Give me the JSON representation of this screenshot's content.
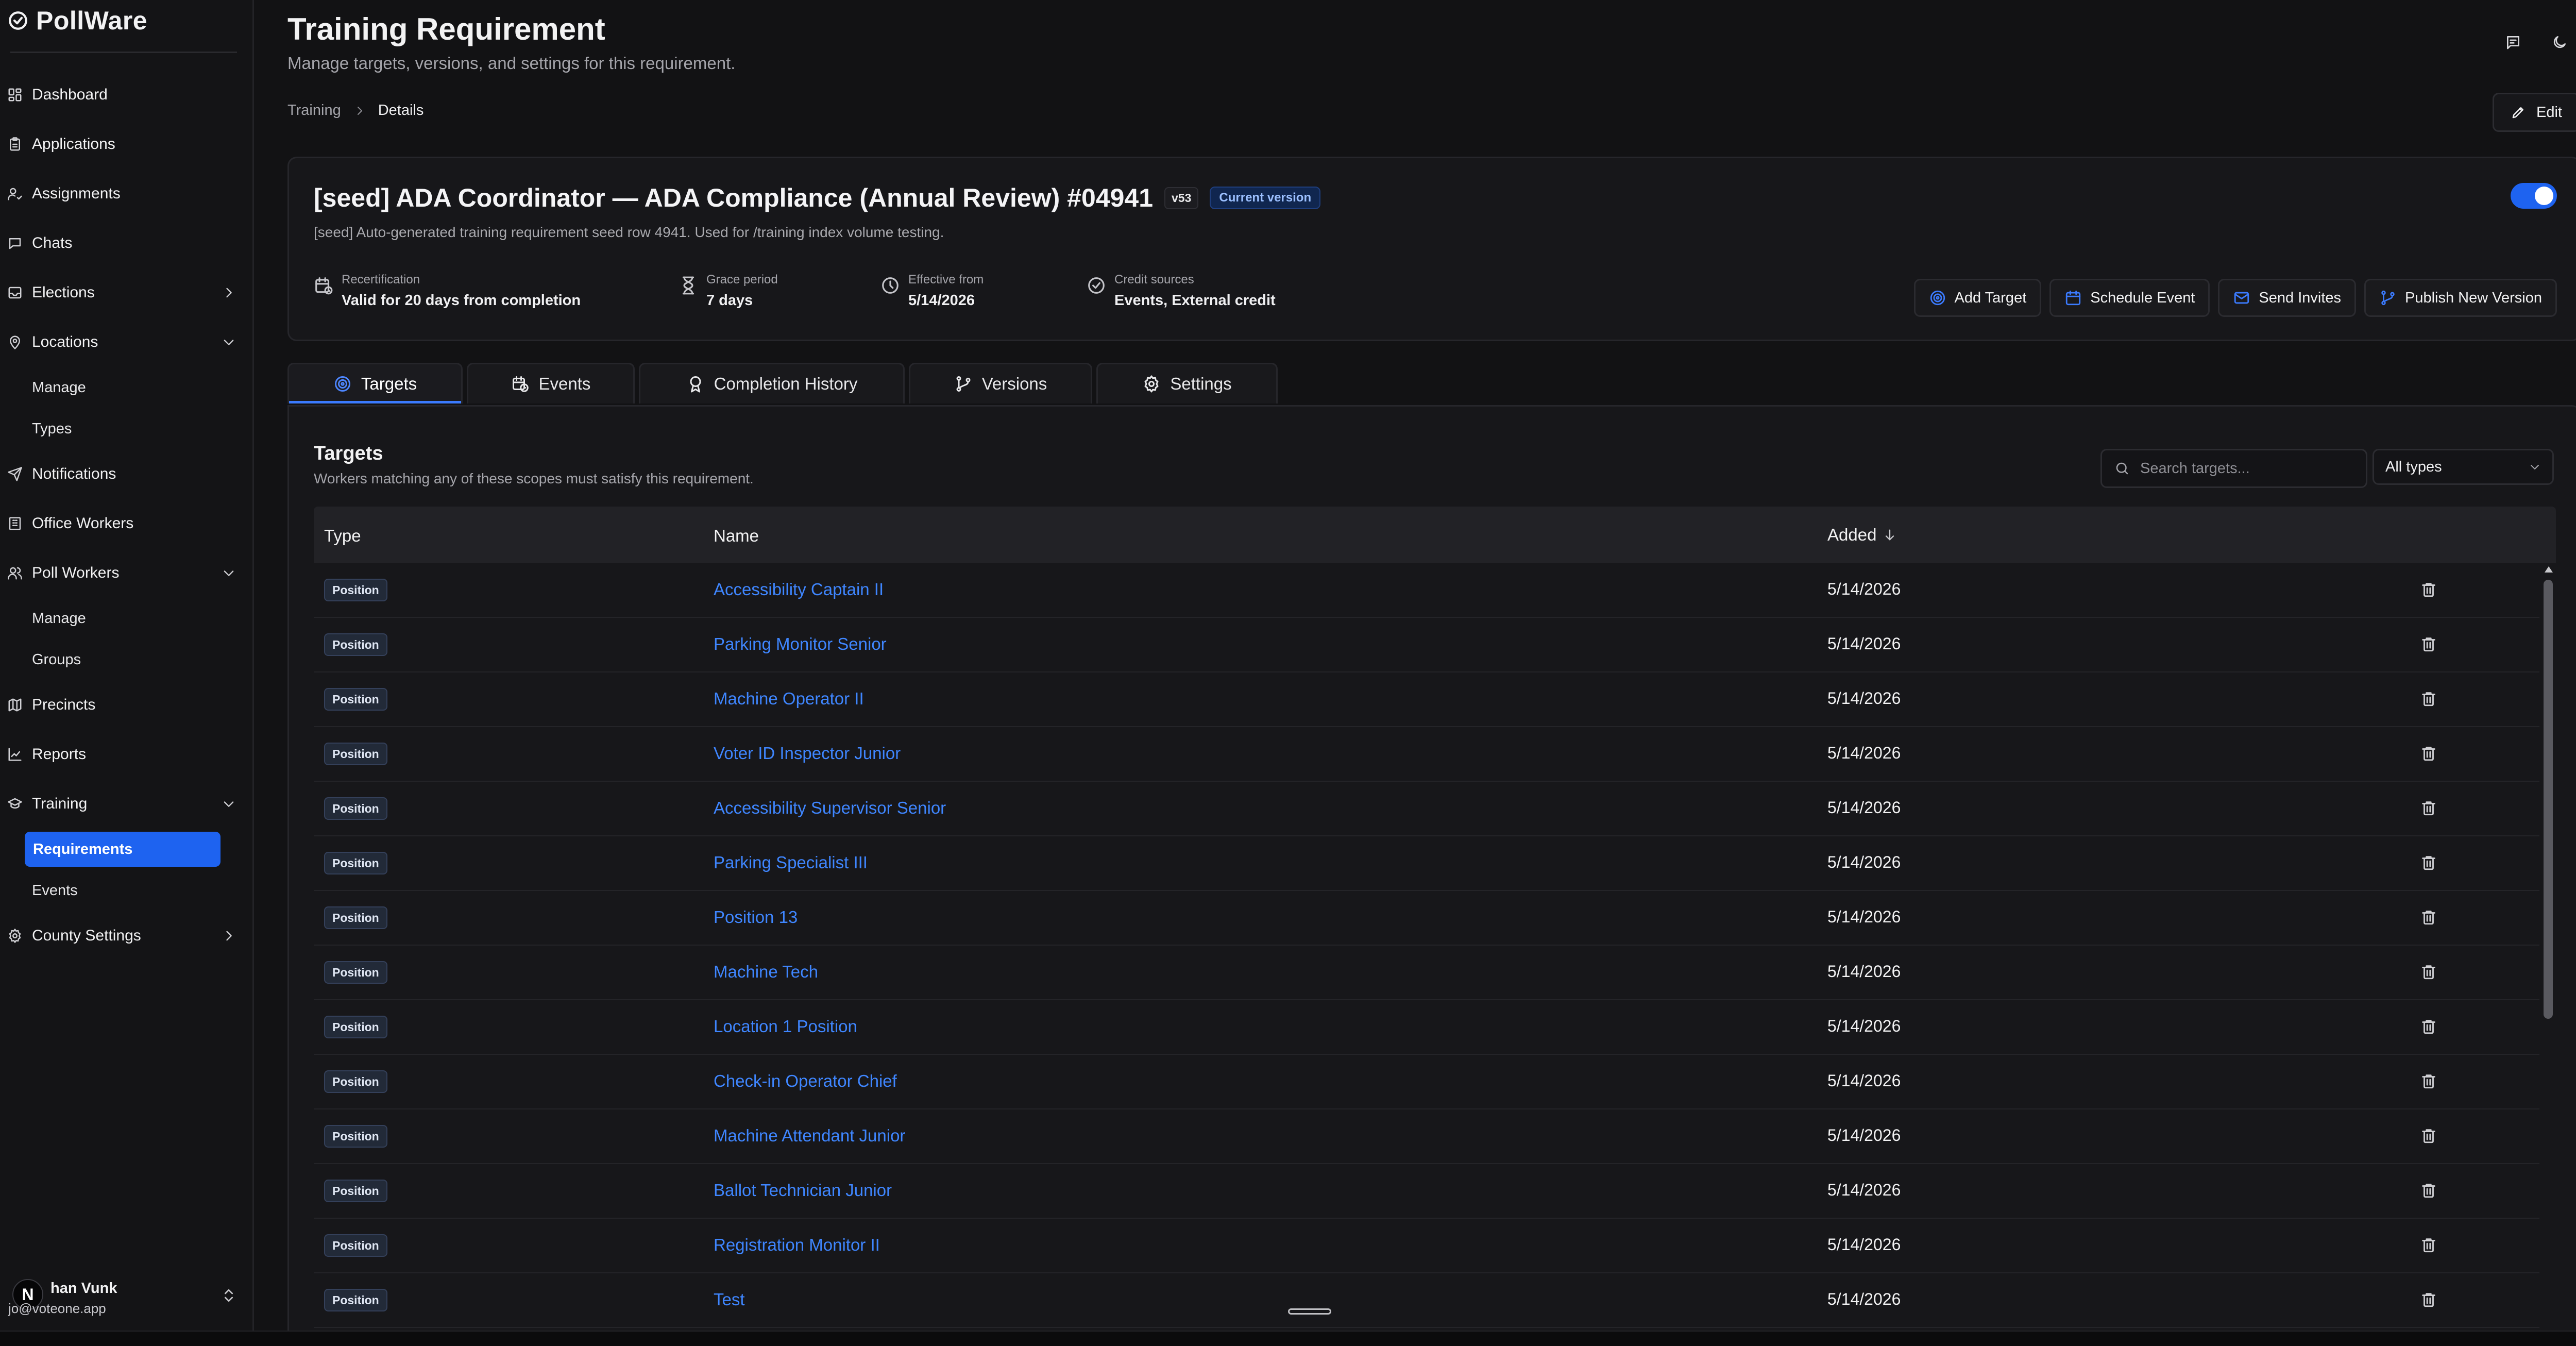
{
  "brand": {
    "name": "PollWare"
  },
  "sidebar": {
    "items": [
      {
        "key": "dashboard",
        "label": "Dashboard",
        "icon": "dashboard-icon"
      },
      {
        "key": "applications",
        "label": "Applications",
        "icon": "clipboard-icon"
      },
      {
        "key": "assignments",
        "label": "Assignments",
        "icon": "user-check-icon"
      },
      {
        "key": "chats",
        "label": "Chats",
        "icon": "chat-icon"
      },
      {
        "key": "elections",
        "label": "Elections",
        "icon": "inbox-icon",
        "chevron": "right"
      },
      {
        "key": "locations",
        "label": "Locations",
        "icon": "map-pin-icon",
        "chevron": "down"
      },
      {
        "key": "notifications",
        "label": "Notifications",
        "icon": "send-icon"
      },
      {
        "key": "office-workers",
        "label": "Office Workers",
        "icon": "building-icon"
      },
      {
        "key": "poll-workers",
        "label": "Poll Workers",
        "icon": "users-icon",
        "chevron": "down"
      },
      {
        "key": "precincts",
        "label": "Precincts",
        "icon": "map-icon"
      },
      {
        "key": "reports",
        "label": "Reports",
        "icon": "chart-icon"
      },
      {
        "key": "training",
        "label": "Training",
        "icon": "graduation-cap-icon",
        "chevron": "down"
      },
      {
        "key": "county-settings",
        "label": "County Settings",
        "icon": "gear-icon",
        "chevron": "right"
      }
    ],
    "locations_sub": [
      "Manage",
      "Types"
    ],
    "poll_workers_sub": [
      "Manage",
      "Groups"
    ],
    "training_sub": [
      "Requirements",
      "Events"
    ],
    "active_sub": "Requirements"
  },
  "user": {
    "avatar_letter": "N",
    "name": "han Vunk",
    "email": "jo@voteone.app"
  },
  "header": {
    "title": "Training Requirement",
    "subtitle": "Manage targets, versions, and settings for this requirement.",
    "breadcrumb": [
      "Training",
      "Details"
    ],
    "edit_label": "Edit"
  },
  "requirement": {
    "title": "[seed] ADA Coordinator — ADA Compliance (Annual Review) #04941",
    "version": "v53",
    "version_badge": "Current version",
    "description": "[seed] Auto-generated training requirement seed row 4941. Used for /training index volume testing.",
    "enabled": true,
    "meta": [
      {
        "label": "Recertification",
        "value": "Valid for 20 days from completion",
        "icon": "calendar-refresh-icon"
      },
      {
        "label": "Grace period",
        "value": "7 days",
        "icon": "hourglass-icon"
      },
      {
        "label": "Effective from",
        "value": "5/14/2026",
        "icon": "clock-icon"
      },
      {
        "label": "Credit sources",
        "value": "Events, External credit",
        "icon": "badge-check-icon"
      }
    ],
    "actions": [
      {
        "label": "Add Target",
        "icon": "target-icon"
      },
      {
        "label": "Schedule Event",
        "icon": "calendar-icon"
      },
      {
        "label": "Send Invites",
        "icon": "mail-icon"
      },
      {
        "label": "Publish New Version",
        "icon": "git-branch-icon"
      }
    ]
  },
  "tabs": [
    {
      "label": "Targets",
      "icon": "target-icon",
      "active": true
    },
    {
      "label": "Events",
      "icon": "calendar-clock-icon",
      "active": false
    },
    {
      "label": "Completion History",
      "icon": "award-icon",
      "active": false
    },
    {
      "label": "Versions",
      "icon": "git-branch-icon",
      "active": false
    },
    {
      "label": "Settings",
      "icon": "gear-icon",
      "active": false
    }
  ],
  "targets": {
    "title": "Targets",
    "subtitle": "Workers matching any of these scopes must satisfy this requirement.",
    "search_placeholder": "Search targets...",
    "type_filter": "All types",
    "columns": {
      "type": "Type",
      "name": "Name",
      "added": "Added"
    },
    "rows": [
      {
        "type": "Position",
        "name": "Accessibility Captain II",
        "added": "5/14/2026"
      },
      {
        "type": "Position",
        "name": "Parking Monitor Senior",
        "added": "5/14/2026"
      },
      {
        "type": "Position",
        "name": "Machine Operator II",
        "added": "5/14/2026"
      },
      {
        "type": "Position",
        "name": "Voter ID Inspector Junior",
        "added": "5/14/2026"
      },
      {
        "type": "Position",
        "name": "Accessibility Supervisor Senior",
        "added": "5/14/2026"
      },
      {
        "type": "Position",
        "name": "Parking Specialist III",
        "added": "5/14/2026"
      },
      {
        "type": "Position",
        "name": "Position 13",
        "added": "5/14/2026"
      },
      {
        "type": "Position",
        "name": "Machine Tech",
        "added": "5/14/2026"
      },
      {
        "type": "Position",
        "name": "Location 1 Position",
        "added": "5/14/2026"
      },
      {
        "type": "Position",
        "name": "Check-in Operator Chief",
        "added": "5/14/2026"
      },
      {
        "type": "Position",
        "name": "Machine Attendant Junior",
        "added": "5/14/2026"
      },
      {
        "type": "Position",
        "name": "Ballot Technician Junior",
        "added": "5/14/2026"
      },
      {
        "type": "Position",
        "name": "Registration Monitor II",
        "added": "5/14/2026"
      },
      {
        "type": "Position",
        "name": "Test",
        "added": "5/14/2026"
      }
    ]
  },
  "colors": {
    "accent": "#1e63f0",
    "link": "#3f86ff",
    "background": "#121214"
  }
}
